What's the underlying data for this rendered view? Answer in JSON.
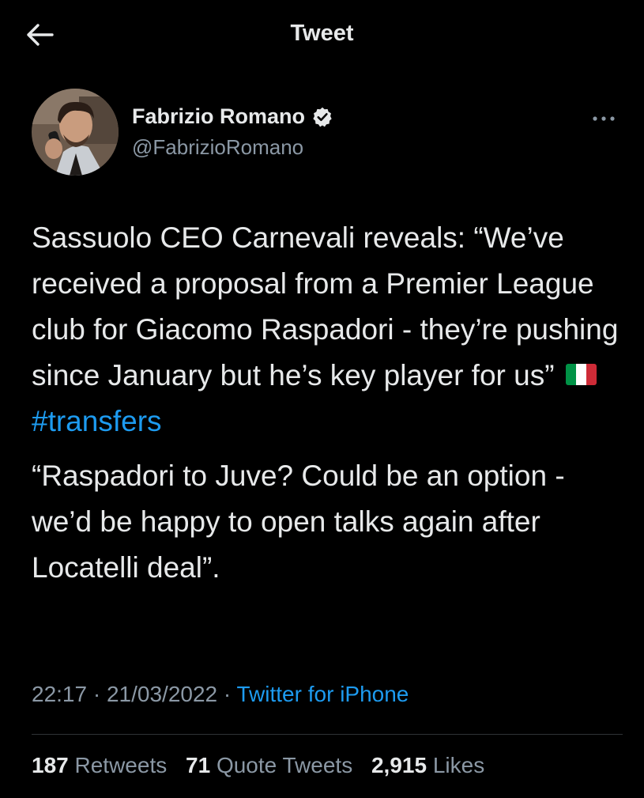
{
  "header": {
    "title": "Tweet",
    "back_icon": "arrow-left-icon"
  },
  "author": {
    "display_name": "Fabrizio Romano",
    "handle": "@FabrizioRomano",
    "verified_icon": "verified-badge-icon",
    "more_icon": "more-horizontal-icon"
  },
  "tweet": {
    "para1": "Sassuolo CEO Carnevali reveals: “We’ve received a proposal from a Premier League club for Giacomo Raspadori - they’re pushing since January but he’s key player for us”",
    "flag_icon": "italy-flag-icon",
    "hashtag": "#transfers",
    "para2": "“Raspadori to Juve? Could be an option - we’d be happy to open talks again after Locatelli deal”."
  },
  "meta": {
    "time": "22:17",
    "date": "21/03/2022",
    "separator": "·",
    "source": "Twitter for iPhone"
  },
  "stats": {
    "retweets_count": "187",
    "retweets_label": "Retweets",
    "quote_count": "71",
    "quote_label": "Quote Tweets",
    "likes_count": "2,915",
    "likes_label": "Likes"
  },
  "colors": {
    "background": "#000000",
    "text": "#e7e9ea",
    "secondary": "#8b98a5",
    "accent": "#1d9bf0",
    "divider": "#2f3336"
  }
}
